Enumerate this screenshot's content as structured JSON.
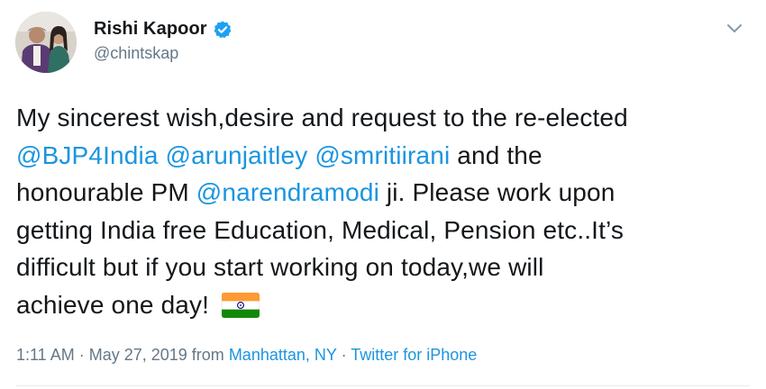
{
  "user": {
    "display_name": "Rishi Kapoor",
    "handle": "@chintskap",
    "verified": true,
    "verified_color": "#1da1f2"
  },
  "tweet": {
    "lines": [
      [
        {
          "text": "My sincerest wish,desire and request to the re-elected",
          "mention": false
        }
      ],
      [
        {
          "text": "@BJP4India",
          "mention": true
        },
        {
          "text": " ",
          "mention": false
        },
        {
          "text": "@arunjaitley",
          "mention": true
        },
        {
          "text": " ",
          "mention": false
        },
        {
          "text": "@smritiirani",
          "mention": true
        },
        {
          "text": " and the",
          "mention": false
        }
      ],
      [
        {
          "text": "honourable PM ",
          "mention": false
        },
        {
          "text": "@narendramodi",
          "mention": true
        },
        {
          "text": " ji. Please work  upon",
          "mention": false
        }
      ],
      [
        {
          "text": "getting India free Education, Medical, Pension etc..It’s",
          "mention": false
        }
      ],
      [
        {
          "text": "difficult but if you start working on today,we will",
          "mention": false
        }
      ],
      [
        {
          "text": "achieve one day!",
          "mention": false
        }
      ]
    ],
    "emoji": "india-flag-icon"
  },
  "meta": {
    "time": "1:11 AM",
    "sep1": " · ",
    "date": "May 27, 2019",
    "from_label": " from ",
    "location": "Manhattan, NY",
    "sep2": " · ",
    "source": "Twitter for iPhone"
  },
  "colors": {
    "link": "#1b95e0",
    "text": "#14171a",
    "secondary": "#657786"
  }
}
